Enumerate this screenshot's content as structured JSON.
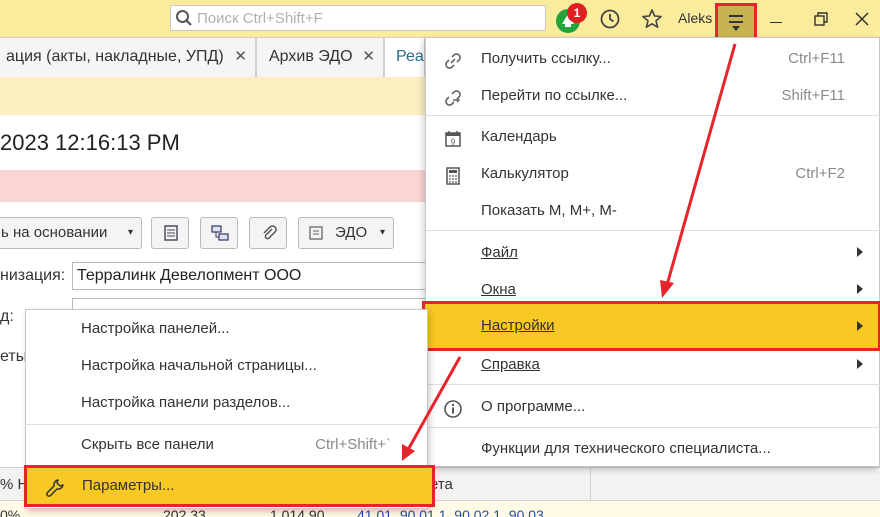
{
  "search": {
    "placeholder": "Поиск Ctrl+Shift+F"
  },
  "notifications": {
    "count": "1"
  },
  "user": {
    "name": "Aleks"
  },
  "tabs": [
    {
      "label": "ация (акты, накладные, УПД)"
    },
    {
      "label": "Архив ЭДО"
    },
    {
      "label": "Реа"
    }
  ],
  "document": {
    "title": "2023 12:16:13 PM",
    "toolbar": {
      "create_based_on": "ь на основании",
      "edo": "ЭДО"
    },
    "org_label": "низация:",
    "org_value": "Терралинк Девелопмент ООО",
    "label2": "д:",
    "label3": "еты"
  },
  "table": {
    "header_left": "% Н",
    "header_right": "ета",
    "row_values": [
      "0%",
      "202,33",
      "1 014,90",
      "41.01, 90.01.1, 90.02.1, 90.03"
    ]
  },
  "main_menu": {
    "items": [
      {
        "label": "Получить ссылку...",
        "shortcut": "Ctrl+F11",
        "icon": "link-icon"
      },
      {
        "label": "Перейти по ссылке...",
        "shortcut": "Shift+F11",
        "icon": "goto-link-icon"
      },
      {
        "label": "Календарь",
        "shortcut": "",
        "icon": "calendar-icon"
      },
      {
        "label": "Калькулятор",
        "shortcut": "Ctrl+F2",
        "icon": "calculator-icon"
      },
      {
        "label": "Показать M, M+, M-",
        "shortcut": "",
        "icon": ""
      },
      {
        "label": "Файл",
        "submenu": true
      },
      {
        "label": "Окна",
        "submenu": true
      },
      {
        "label": "Настройки",
        "submenu": true
      },
      {
        "label": "Справка",
        "submenu": true
      },
      {
        "label": "О программе...",
        "icon": "info-icon"
      },
      {
        "label": "Функции для технического специалиста..."
      }
    ]
  },
  "settings_submenu": {
    "items": [
      {
        "label": "Настройка панелей..."
      },
      {
        "label": "Настройка начальной страницы..."
      },
      {
        "label": "Настройка панели разделов..."
      },
      {
        "label": "Скрыть все панели",
        "shortcut": "Ctrl+Shift+`"
      },
      {
        "label": "Параметры...",
        "icon": "wrench-icon"
      }
    ]
  },
  "colors": {
    "highlight": "#f8c824",
    "callout": "#e8242b",
    "topbar": "#fbeb9c"
  }
}
